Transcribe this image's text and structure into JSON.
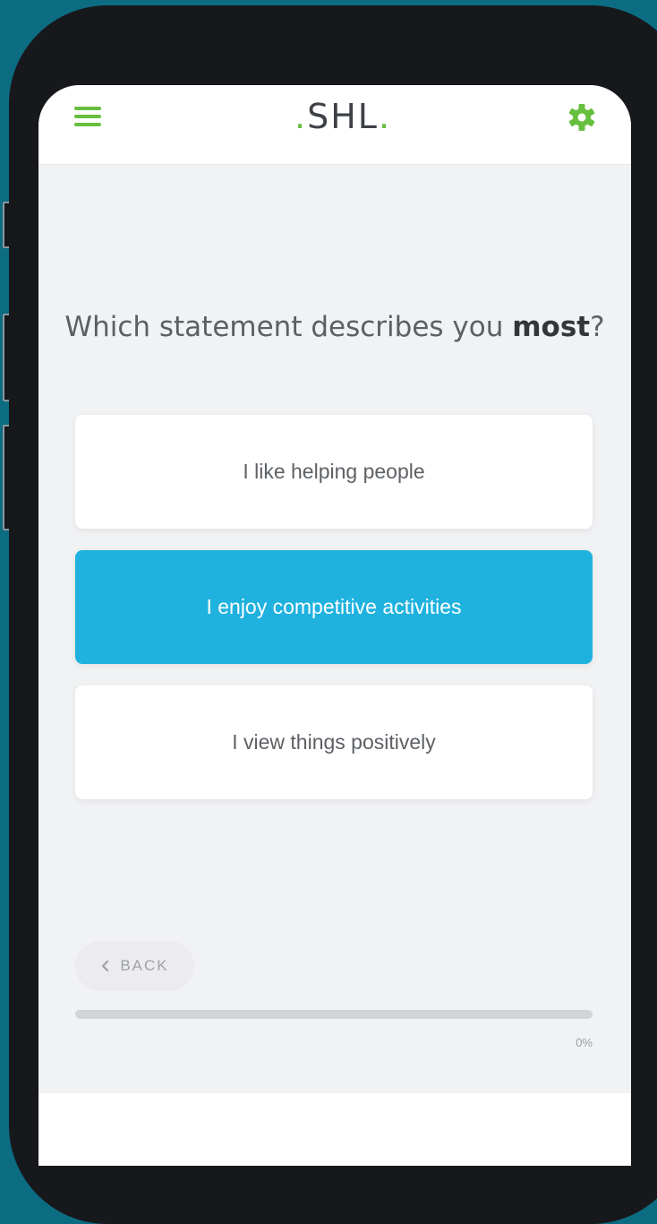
{
  "header": {
    "logo_text": "SHL",
    "accent_color": "#67bf3f"
  },
  "question": {
    "prefix": "Which statement describes you ",
    "emphasis": "most",
    "suffix": "?"
  },
  "options": [
    {
      "label": "I like helping people",
      "selected": false
    },
    {
      "label": "I enjoy competitive activities",
      "selected": true
    },
    {
      "label": "I view things positively",
      "selected": false
    }
  ],
  "selected_color": "#1fb2df",
  "navigation": {
    "back_label": "BACK",
    "back_icon": "chevron-left-icon"
  },
  "progress": {
    "value": 0,
    "label": "0%"
  }
}
